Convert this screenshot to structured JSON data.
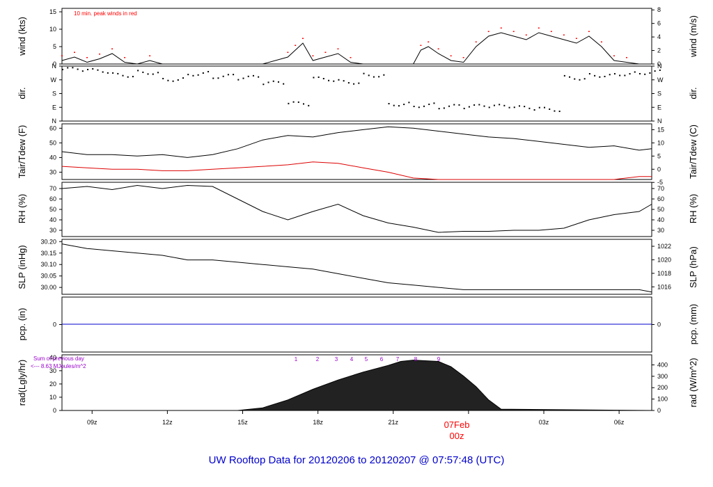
{
  "title": "UW Rooftop Data for 20120206  to  20120207 @ 07:57:48  (UTC)",
  "colors": {
    "wind": "#000000",
    "peak": "#ff0000",
    "tair": "#000000",
    "tdew": "#dd0000",
    "pcp": "#0000cc",
    "rad": "#000000",
    "title": "#0000cc",
    "date": "#ff0000",
    "rad_hours": "#9900cc"
  },
  "x_axis": {
    "ticks": [
      "09z",
      "12z",
      "15z",
      "18z",
      "21z",
      "03z",
      "06z"
    ],
    "date_label": "07Feb",
    "date_sub": "00z",
    "hours_range_note": ""
  },
  "panels": {
    "wind": {
      "ylabel_left": "wind (kts)",
      "ylabel_right": "wind (m/s)",
      "annotation": "10 min. peak winds in red",
      "left_ticks": [
        "0",
        "5",
        "10",
        "15"
      ],
      "right_ticks": [
        "0",
        "2",
        "4",
        "6",
        "8"
      ]
    },
    "dir": {
      "ylabel_left": "dir.",
      "ylabel_right": "dir.",
      "ticks": [
        "N",
        "E",
        "S",
        "W",
        "N"
      ]
    },
    "temp": {
      "ylabel_left": "Tair/Tdew (F)",
      "ylabel_right": "Tair/Tdew (C)",
      "left_ticks": [
        "30",
        "40",
        "50",
        "60"
      ],
      "right_ticks": [
        "-5",
        "0",
        "5",
        "10",
        "15"
      ]
    },
    "rh": {
      "ylabel_left": "RH (%)",
      "ylabel_right": "RH (%)",
      "left_ticks": [
        "30",
        "40",
        "50",
        "60",
        "70"
      ],
      "right_ticks": [
        "30",
        "40",
        "50",
        "60",
        "70"
      ]
    },
    "slp": {
      "ylabel_left": "SLP (inHg)",
      "ylabel_right": "SLP (hPa)",
      "left_ticks": [
        "30.00",
        "30.05",
        "30.10",
        "30.15",
        "30.20"
      ],
      "right_ticks": [
        "1016",
        "1018",
        "1020",
        "1022"
      ]
    },
    "pcp": {
      "ylabel_left": "pcp. (in)",
      "ylabel_right": "pcp. (mm)",
      "left_ticks": [
        "0"
      ],
      "right_ticks": [
        "0"
      ]
    },
    "rad": {
      "ylabel_left": "rad(Lgly/hr)",
      "ylabel_right": "rad (W/m^2)",
      "left_ticks": [
        "0",
        "10",
        "20",
        "30",
        "40"
      ],
      "right_ticks": [
        "0",
        "100",
        "200",
        "300",
        "400"
      ],
      "sum_line1": "Sum of previous day",
      "sum_line2": "<--- 8.63 MJoules/m^2",
      "hour_marks": [
        "1",
        "2",
        "3",
        "4",
        "5",
        "6",
        "7",
        "8",
        "9"
      ]
    }
  },
  "chart_data": [
    {
      "type": "line",
      "title": "",
      "ylabel": "wind (kts)",
      "ylim": [
        0,
        16
      ],
      "x_unit": "hours since 07:48 UTC 20120206",
      "series": [
        {
          "name": "wind",
          "x": [
            0,
            0.5,
            1,
            1.5,
            2,
            2.5,
            3,
            3.5,
            4,
            5,
            6,
            7,
            8,
            9,
            9.3,
            9.6,
            10,
            10.5,
            11,
            11.5,
            12,
            13,
            14,
            14.3,
            14.6,
            15,
            15.5,
            16,
            16.5,
            17,
            17.5,
            18,
            18.5,
            19,
            19.5,
            20,
            20.5,
            21,
            21.5,
            22,
            22.5,
            23,
            23.5
          ],
          "y": [
            1,
            2,
            0.5,
            1.5,
            3,
            0.5,
            0,
            1,
            0,
            0,
            0,
            0,
            0,
            2,
            4,
            6,
            1,
            2,
            3,
            0.5,
            0,
            0,
            0,
            4,
            5,
            3,
            1,
            0.5,
            5,
            8,
            9,
            8,
            7,
            9,
            8,
            7,
            6,
            8,
            5,
            1,
            0.5,
            0,
            0
          ]
        }
      ]
    },
    {
      "type": "scatter",
      "title": "",
      "ylabel": "dir.",
      "yticks": [
        "N",
        "E",
        "S",
        "W",
        "N"
      ],
      "note": "wind direction dots"
    },
    {
      "type": "line",
      "title": "",
      "ylabel": "Tair/Tdew (F)",
      "ylim": [
        25,
        63
      ],
      "x_unit": "hours since 07:48 UTC 20120206",
      "series": [
        {
          "name": "Tair",
          "x": [
            0,
            1,
            2,
            3,
            4,
            5,
            6,
            7,
            8,
            9,
            10,
            11,
            12,
            13,
            14,
            15,
            16,
            17,
            18,
            19,
            20,
            21,
            22,
            23,
            23.5
          ],
          "y": [
            44,
            42,
            42,
            41,
            42,
            40,
            42,
            46,
            52,
            55,
            54,
            57,
            59,
            61,
            60,
            58,
            56,
            54,
            53,
            51,
            49,
            47,
            48,
            45,
            46
          ]
        },
        {
          "name": "Tdew",
          "x": [
            0,
            1,
            2,
            3,
            4,
            5,
            6,
            7,
            8,
            9,
            10,
            11,
            12,
            13,
            14,
            15,
            16,
            17,
            18,
            19,
            20,
            21,
            22,
            23,
            23.5
          ],
          "y": [
            34,
            33,
            32,
            32,
            31,
            31,
            32,
            33,
            34,
            35,
            37,
            36,
            33,
            30,
            26,
            25,
            25,
            25,
            24,
            24,
            24,
            24,
            25,
            27,
            27
          ]
        }
      ]
    },
    {
      "type": "line",
      "title": "",
      "ylabel": "RH (%)",
      "ylim": [
        24,
        76
      ],
      "x_unit": "hours since 07:48 UTC 20120206",
      "series": [
        {
          "name": "RH",
          "x": [
            0,
            1,
            2,
            3,
            4,
            5,
            6,
            7,
            8,
            9,
            10,
            11,
            12,
            13,
            14,
            15,
            16,
            17,
            18,
            19,
            20,
            21,
            22,
            23,
            23.5
          ],
          "y": [
            70,
            72,
            69,
            73,
            70,
            73,
            72,
            60,
            48,
            40,
            48,
            55,
            44,
            37,
            33,
            28,
            29,
            29,
            30,
            30,
            32,
            40,
            45,
            48,
            55
          ]
        }
      ]
    },
    {
      "type": "line",
      "title": "",
      "ylabel": "SLP (inHg)",
      "ylim": [
        29.97,
        30.21
      ],
      "x_unit": "hours since 07:48 UTC 20120206",
      "series": [
        {
          "name": "SLP",
          "x": [
            0,
            1,
            2,
            3,
            4,
            5,
            6,
            7,
            8,
            9,
            10,
            11,
            12,
            13,
            14,
            15,
            16,
            17,
            18,
            19,
            20,
            21,
            22,
            23,
            23.5
          ],
          "y": [
            30.19,
            30.17,
            30.16,
            30.15,
            30.14,
            30.12,
            30.12,
            30.11,
            30.1,
            30.09,
            30.08,
            30.06,
            30.04,
            30.02,
            30.01,
            30.0,
            29.99,
            29.99,
            29.99,
            29.99,
            29.99,
            29.99,
            29.99,
            29.99,
            29.98
          ]
        }
      ]
    },
    {
      "type": "line",
      "title": "",
      "ylabel": "pcp. (in)",
      "series": [
        {
          "name": "pcp",
          "x": [
            0,
            23.5
          ],
          "y": [
            0,
            0
          ]
        }
      ]
    },
    {
      "type": "area",
      "title": "",
      "ylabel": "rad(Lgly/hr)",
      "ylim": [
        0,
        40
      ],
      "x_unit": "hours since 07:48 UTC 20120206",
      "series": [
        {
          "name": "rad",
          "x": [
            0,
            7,
            8,
            9,
            10,
            11,
            12,
            13,
            13.5,
            14,
            15,
            15.5,
            16,
            16.5,
            17,
            17.5,
            23.5
          ],
          "y": [
            0,
            0,
            2,
            8,
            16,
            23,
            29,
            34,
            37,
            38,
            37,
            33,
            26,
            18,
            8,
            1,
            0
          ]
        }
      ]
    }
  ]
}
